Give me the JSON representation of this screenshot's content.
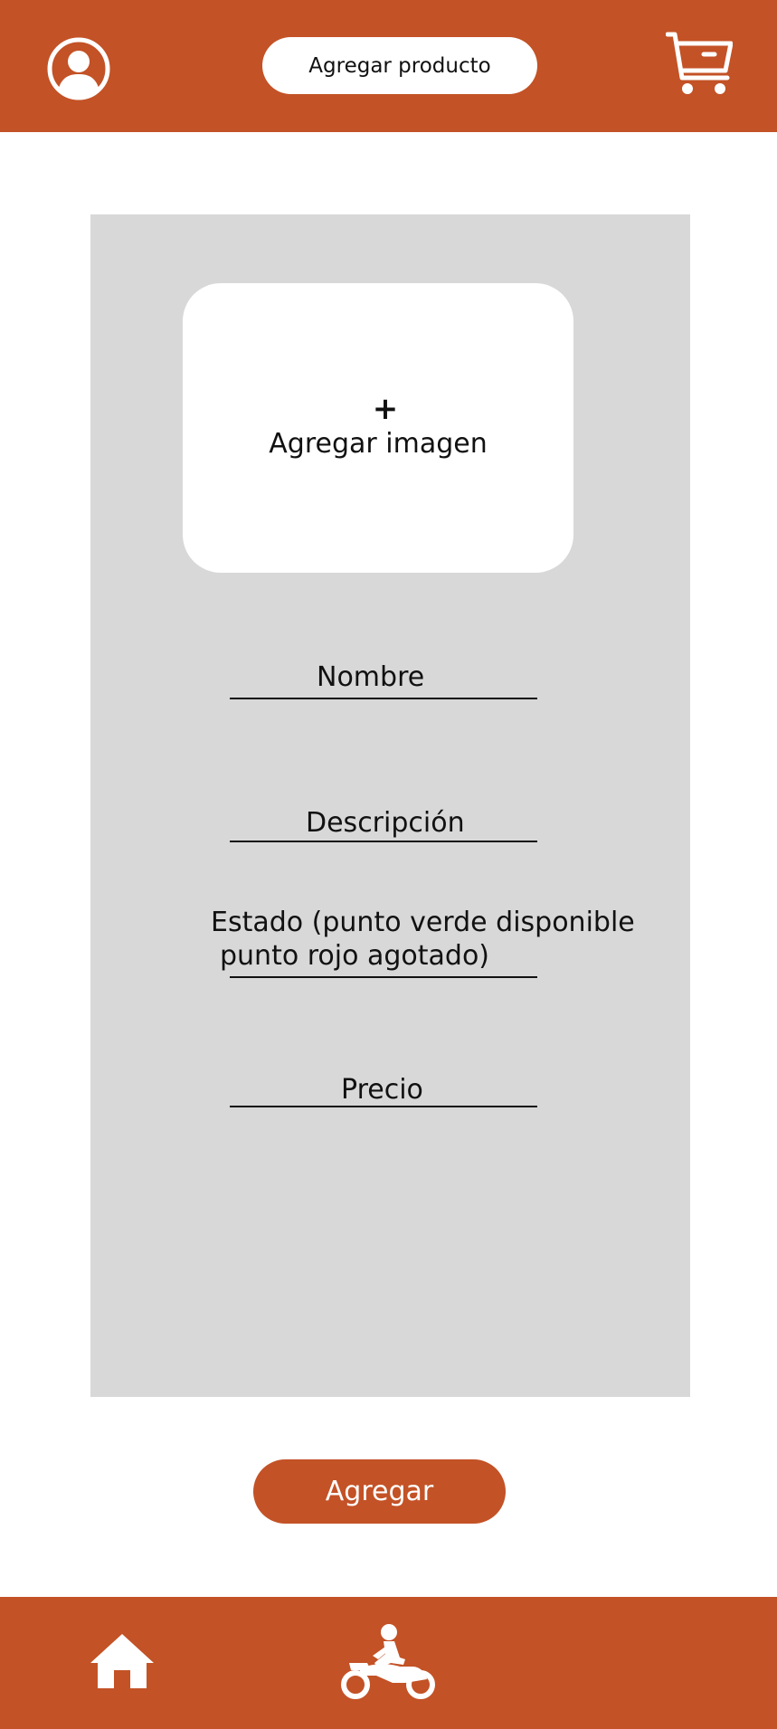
{
  "header": {
    "title": "Agregar producto",
    "icons": {
      "profile": "user-circle-icon",
      "cart": "shopping-cart-icon"
    }
  },
  "form": {
    "image_upload": {
      "plus": "+",
      "label": "Agregar imagen"
    },
    "fields": {
      "name": "Nombre",
      "description": "Descripción",
      "status_line1": "Estado (punto verde disponible",
      "status_line2": "punto rojo agotado)",
      "price": "Precio"
    },
    "submit_label": "Agregar"
  },
  "bottom_nav": {
    "items": [
      {
        "icon": "home-icon"
      },
      {
        "icon": "motorcycle-icon"
      }
    ]
  },
  "colors": {
    "brand": "#c35226",
    "panel": "#d8d8d8",
    "background": "#ffffff"
  }
}
